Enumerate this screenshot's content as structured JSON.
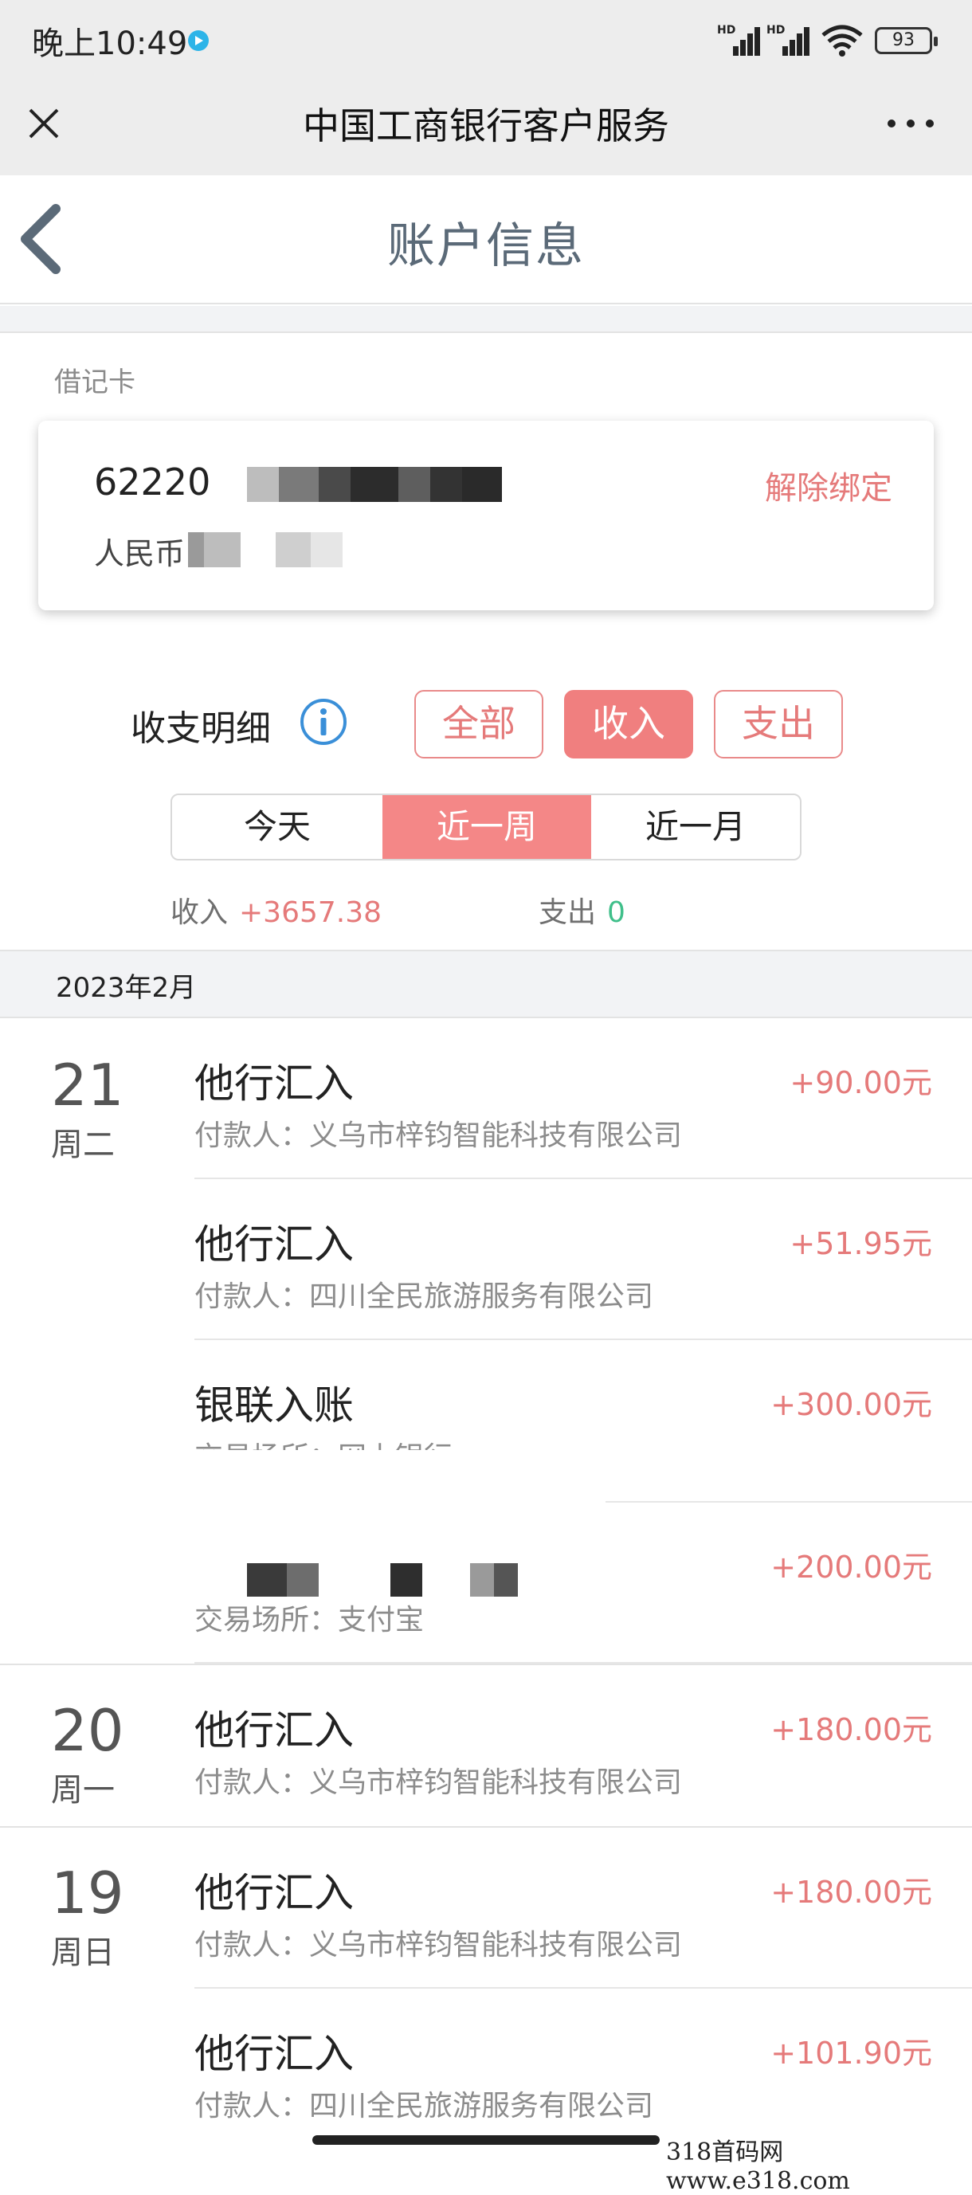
{
  "status_bar": {
    "time": "晚上10:49",
    "signal_label": "HD",
    "battery": "93"
  },
  "webview": {
    "title": "中国工商银行客户服务"
  },
  "page": {
    "title": "账户信息"
  },
  "card": {
    "section_label": "借记卡",
    "number_visible": "62220",
    "currency_visible": "人民币",
    "unbind_label": "解除绑定"
  },
  "filters": {
    "detail_label": "收支明细",
    "types": [
      {
        "label": "全部",
        "active": false
      },
      {
        "label": "收入",
        "active": true
      },
      {
        "label": "支出",
        "active": false
      }
    ],
    "periods": [
      {
        "label": "今天",
        "active": false
      },
      {
        "label": "近一周",
        "active": true
      },
      {
        "label": "近一月",
        "active": false
      }
    ]
  },
  "summary": {
    "income_label": "收入",
    "income_value": "+3657.38",
    "expense_label": "支出",
    "expense_value": "0"
  },
  "list": {
    "month": "2023年2月",
    "days": [
      {
        "day": "21",
        "weekday": "周二",
        "transactions": [
          {
            "title": "他行汇入",
            "subtitle": "付款人：义乌市梓钧智能科技有限公司",
            "amount": "+90.00元"
          },
          {
            "title": "他行汇入",
            "subtitle": "付款人：四川全民旅游服务有限公司",
            "amount": "+51.95元"
          },
          {
            "title": "银联入账",
            "subtitle": "交易场所：网上银行",
            "amount": "+300.00元"
          },
          {
            "title": "",
            "subtitle": "交易场所：支付宝",
            "amount": "+200.00元"
          }
        ]
      },
      {
        "day": "20",
        "weekday": "周一",
        "transactions": [
          {
            "title": "他行汇入",
            "subtitle": "付款人：义乌市梓钧智能科技有限公司",
            "amount": "+180.00元"
          }
        ]
      },
      {
        "day": "19",
        "weekday": "周日",
        "transactions": [
          {
            "title": "他行汇入",
            "subtitle": "付款人：义乌市梓钧智能科技有限公司",
            "amount": "+180.00元"
          },
          {
            "title": "他行汇入",
            "subtitle": "付款人：四川全民旅游服务有限公司",
            "amount": "+101.90元"
          }
        ]
      }
    ]
  },
  "watermark": "318首码网 www.e318.com",
  "colors": {
    "accent": "#f07f7f",
    "amount": "#e57a7a",
    "expense_zero": "#3fbf8a",
    "title_gray": "#5b6a78"
  }
}
